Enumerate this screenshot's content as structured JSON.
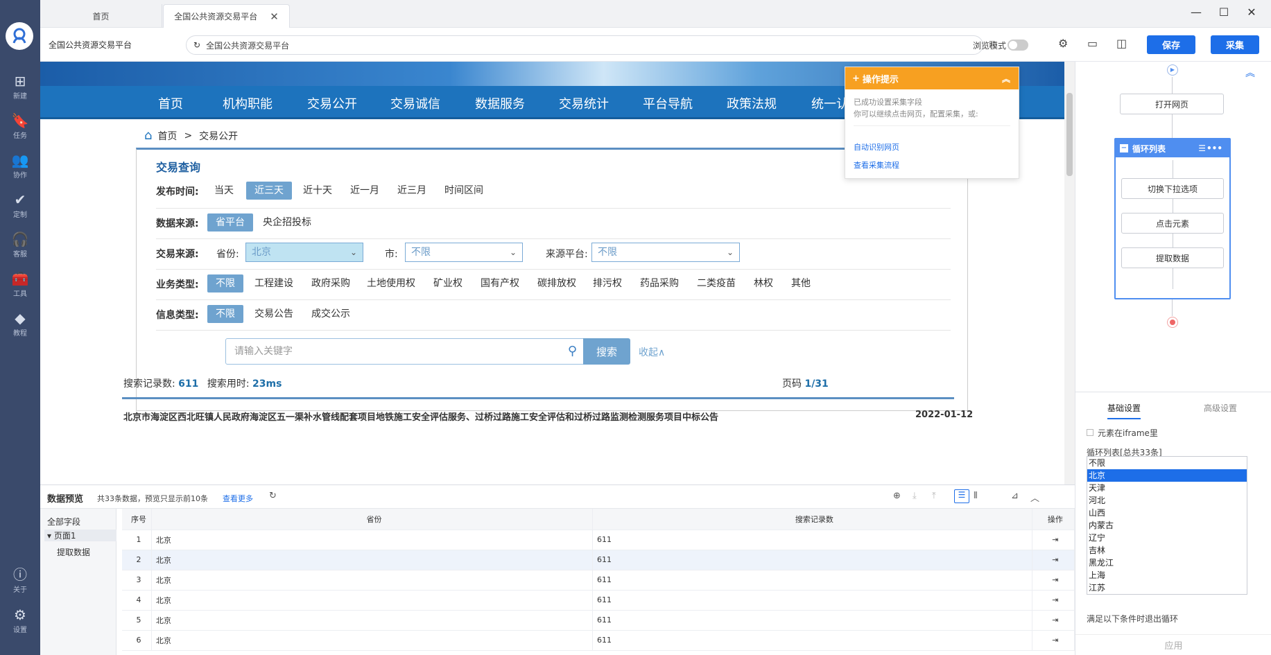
{
  "sidebar": {
    "items": [
      {
        "label": "新建",
        "icon": "plus-box-icon"
      },
      {
        "label": "任务",
        "icon": "bookmark-icon"
      },
      {
        "label": "协作",
        "icon": "users-icon"
      },
      {
        "label": "定制",
        "icon": "badge-check-icon"
      },
      {
        "label": "客服",
        "icon": "headset-icon"
      },
      {
        "label": "工具",
        "icon": "toolbox-icon"
      },
      {
        "label": "教程",
        "icon": "layers-icon"
      },
      {
        "label": "关于",
        "icon": "info-icon"
      },
      {
        "label": "设置",
        "icon": "gear-icon"
      }
    ]
  },
  "tabs": {
    "home": "首页",
    "active": "全国公共资源交易平台"
  },
  "address": {
    "page_title": "全国公共资源交易平台",
    "url": "全国公共资源交易平台",
    "browse_mode": "浏览模式"
  },
  "toolbar": {
    "save": "保存",
    "collect": "采集"
  },
  "site": {
    "nav": [
      "首页",
      "机构职能",
      "交易公开",
      "交易诚信",
      "数据服务",
      "交易统计",
      "平台导航",
      "政策法规",
      "统一认证"
    ],
    "breadcrumb": {
      "home": "首页",
      "sep": ">",
      "current": "交易公开"
    },
    "query": {
      "title": "交易查询",
      "time_label": "发布时间:",
      "time_opts": [
        "当天",
        "近三天",
        "近十天",
        "近一月",
        "近三月",
        "时间区间"
      ],
      "source_label": "数据来源:",
      "source_opts": [
        "省平台",
        "央企招投标"
      ],
      "trade_label": "交易来源:",
      "province_label": "省份:",
      "province_value": "北京",
      "city_label": "市:",
      "city_value": "不限",
      "platform_label": "来源平台:",
      "platform_value": "不限",
      "biz_label": "业务类型:",
      "biz_opts": [
        "不限",
        "工程建设",
        "政府采购",
        "土地使用权",
        "矿业权",
        "国有产权",
        "碳排放权",
        "排污权",
        "药品采购",
        "二类疫苗",
        "林权",
        "其他"
      ],
      "info_label": "信息类型:",
      "info_opts": [
        "不限",
        "交易公告",
        "成交公示"
      ],
      "keyword_placeholder": "请输入关键字",
      "search_btn": "搜索",
      "collapse": "收起∧"
    },
    "stats": {
      "count_label": "搜索记录数:",
      "count": "611",
      "time_label": "搜索用时:",
      "time": "23ms",
      "page_label": "页码",
      "page": "1/31"
    },
    "first_result": {
      "title": "北京市海淀区西北旺镇人民政府海淀区五一渠补水管线配套项目地铁施工安全评估服务、过桥过路施工安全评估和过桥过路监测检测服务项目中标公告",
      "date": "2022-01-12"
    }
  },
  "tip": {
    "title": "操作提示",
    "line1": "已成功设置采集字段",
    "line2": "你可以继续点击网页，配置采集，或:",
    "link1": "自动识别网页",
    "link2": "查看采集流程"
  },
  "flow": {
    "open": "打开网页",
    "loop": "循环列表",
    "switch": "切换下拉选项",
    "click": "点击元素",
    "extract": "提取数据"
  },
  "settings": {
    "tab_basic": "基础设置",
    "tab_adv": "高级设置",
    "iframe": "元素在iframe里",
    "loop_title": "循环列表[总共33条]",
    "items": [
      "不限",
      "北京",
      "天津",
      "河北",
      "山西",
      "内蒙古",
      "辽宁",
      "吉林",
      "黑龙江",
      "上海",
      "江苏"
    ],
    "selected": "北京",
    "exit_label": "满足以下条件时退出循环",
    "apply": "应用"
  },
  "preview": {
    "title": "数据预览",
    "info": "共33条数据，预览只显示前10条",
    "more": "查看更多",
    "tree_all": "全部字段",
    "tree_page": "页面1",
    "tree_extract": "提取数据",
    "cols": [
      "序号",
      "省份",
      "搜索记录数",
      "操作"
    ],
    "rows": [
      [
        "1",
        "北京",
        "611"
      ],
      [
        "2",
        "北京",
        "611"
      ],
      [
        "3",
        "北京",
        "611"
      ],
      [
        "4",
        "北京",
        "611"
      ],
      [
        "5",
        "北京",
        "611"
      ],
      [
        "6",
        "北京",
        "611"
      ]
    ]
  }
}
